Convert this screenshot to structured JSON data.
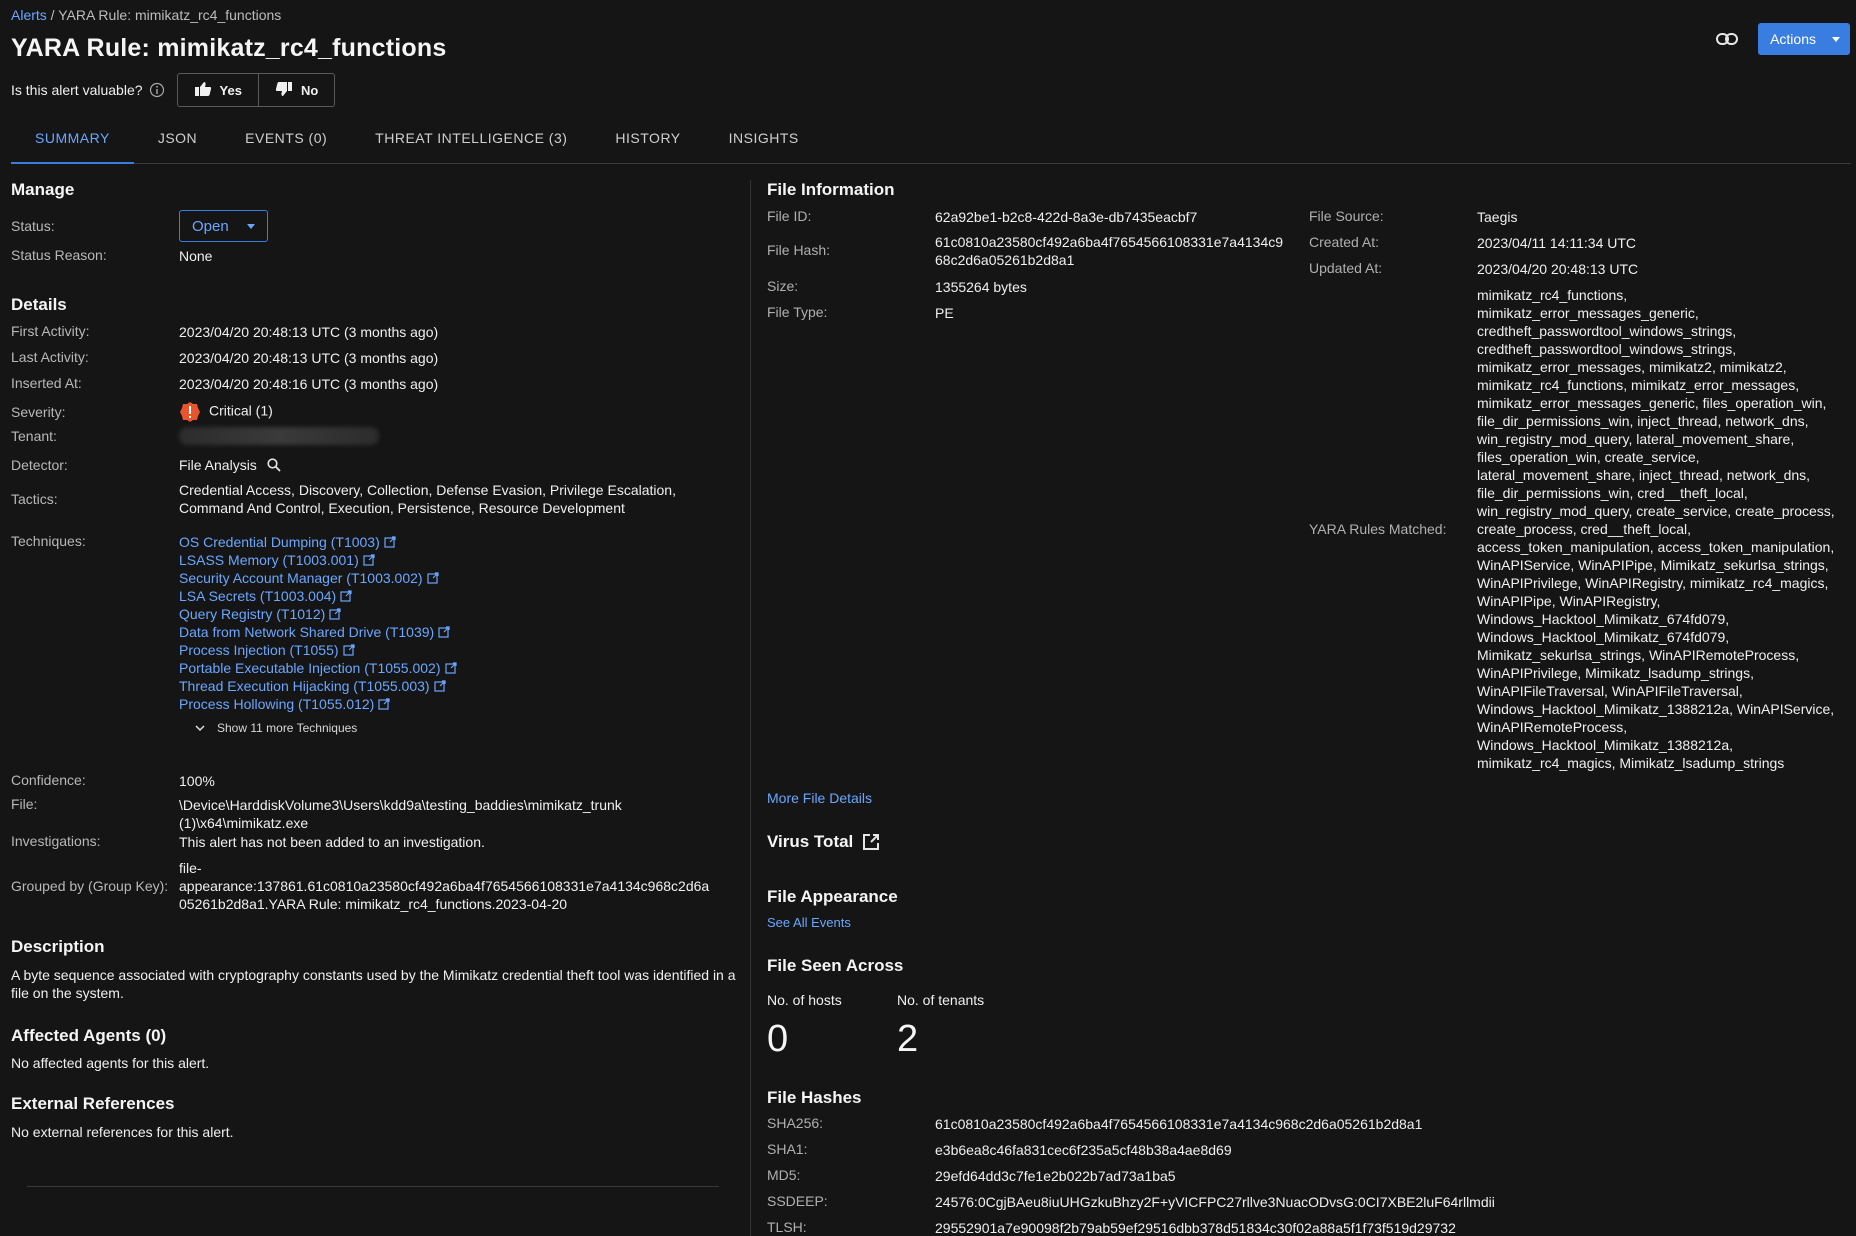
{
  "breadcrumb": {
    "root": "Alerts",
    "sep": " / ",
    "current": "YARA Rule: mimikatz_rc4_functions"
  },
  "title": "YARA Rule: mimikatz_rc4_functions",
  "header": {
    "actions_label": "Actions"
  },
  "feedback": {
    "question": "Is this alert valuable?",
    "yes": "Yes",
    "no": "No"
  },
  "tabs": [
    "SUMMARY",
    "JSON",
    "EVENTS (0)",
    "THREAT INTELLIGENCE (3)",
    "HISTORY",
    "INSIGHTS"
  ],
  "manage": {
    "title": "Manage",
    "status_label": "Status:",
    "status_value": "Open",
    "reason_label": "Status Reason:",
    "reason_value": "None"
  },
  "details": {
    "title": "Details",
    "first_activity_label": "First Activity:",
    "first_activity": "2023/04/20 20:48:13 UTC (3 months ago)",
    "last_activity_label": "Last Activity:",
    "last_activity": "2023/04/20 20:48:13 UTC (3 months ago)",
    "inserted_label": "Inserted At:",
    "inserted": "2023/04/20 20:48:16 UTC (3 months ago)",
    "severity_label": "Severity:",
    "severity": "Critical (1)",
    "tenant_label": "Tenant:",
    "detector_label": "Detector:",
    "detector": "File Analysis",
    "tactics_label": "Tactics:",
    "tactics_line1": "Credential Access, Discovery, Collection, Defense Evasion, Privilege Escalation,",
    "tactics_line2": "Command And Control, Execution, Persistence, Resource Development",
    "techniques_label": "Techniques:",
    "techniques": [
      "OS Credential Dumping (T1003)",
      "LSASS Memory (T1003.001)",
      "Security Account Manager (T1003.002)",
      "LSA Secrets (T1003.004)",
      "Query Registry (T1012)",
      "Data from Network Shared Drive (T1039)",
      "Process Injection (T1055)",
      "Portable Executable Injection (T1055.002)",
      "Thread Execution Hijacking (T1055.003)",
      "Process Hollowing (T1055.012)"
    ],
    "show_more": "Show 11 more Techniques",
    "confidence_label": "Confidence:",
    "confidence": "100%",
    "file_label": "File:",
    "file_line1": "\\Device\\HarddiskVolume3\\Users\\kdd9a\\testing_baddies\\mimikatz_trunk",
    "file_line2": "(1)\\x64\\mimikatz.exe",
    "investigations_label": "Investigations:",
    "investigations": "This alert has not been added to an investigation.",
    "group_label": "Grouped by (Group Key):",
    "group_line1": "file-",
    "group_line2": "appearance:137861.61c0810a23580cf492a6ba4f7654566108331e7a4134c968c2d6a",
    "group_line3": "05261b2d8a1.YARA Rule: mimikatz_rc4_functions.2023-04-20"
  },
  "description": {
    "title": "Description",
    "line1": "A byte sequence associated with cryptography constants used by the Mimikatz credential theft tool was identified in a",
    "line2": "file on the system."
  },
  "agents": {
    "title": "Affected Agents  (0)",
    "text": "No affected agents for this alert."
  },
  "references": {
    "title": "External References",
    "text": "No external references for this alert."
  },
  "file_info": {
    "title": "File Information",
    "id_label": "File ID:",
    "id": "62a92be1-b2c8-422d-8a3e-db7435eacbf7",
    "hash_label": "File Hash:",
    "hash_line1": "61c0810a23580cf492a6ba4f7654566108331e7a4134c9",
    "hash_line2": "68c2d6a05261b2d8a1",
    "size_label": "Size:",
    "size": "1355264 bytes",
    "type_label": "File Type:",
    "type": "PE",
    "source_label": "File Source:",
    "source": "Taegis",
    "created_label": "Created At:",
    "created": "2023/04/11 14:11:34 UTC",
    "updated_label": "Updated At:",
    "updated": "2023/04/20 20:48:13 UTC",
    "yara_label": "YARA Rules Matched:",
    "yara_lines": [
      "mimikatz_rc4_functions,",
      "mimikatz_error_messages_generic,",
      "credtheft_passwordtool_windows_strings,",
      "credtheft_passwordtool_windows_strings,",
      "mimikatz_error_messages, mimikatz2, mimikatz2,",
      "mimikatz_rc4_functions, mimikatz_error_messages,",
      "mimikatz_error_messages_generic, files_operation_win,",
      "file_dir_permissions_win, inject_thread, network_dns,",
      "win_registry_mod_query, lateral_movement_share,",
      "files_operation_win, create_service,",
      "lateral_movement_share, inject_thread, network_dns,",
      "file_dir_permissions_win, cred__theft_local,",
      "win_registry_mod_query, create_service, create_process,",
      "create_process, cred__theft_local,",
      "access_token_manipulation, access_token_manipulation,",
      "WinAPIService, WinAPIPipe, Mimikatz_sekurlsa_strings,",
      "WinAPIPrivilege, WinAPIRegistry, mimikatz_rc4_magics,",
      "WinAPIPipe, WinAPIRegistry,",
      "Windows_Hacktool_Mimikatz_674fd079,",
      "Windows_Hacktool_Mimikatz_674fd079,",
      "Mimikatz_sekurlsa_strings, WinAPIRemoteProcess,",
      "WinAPIPrivilege, Mimikatz_lsadump_strings,",
      "WinAPIFileTraversal, WinAPIFileTraversal,",
      "Windows_Hacktool_Mimikatz_1388212a, WinAPIService,",
      "WinAPIRemoteProcess,",
      "Windows_Hacktool_Mimikatz_1388212a,",
      "mimikatz_rc4_magics, Mimikatz_lsadump_strings"
    ],
    "more_details": "More File Details"
  },
  "virus_total": {
    "title": "Virus Total"
  },
  "appearance": {
    "title": "File Appearance",
    "link": "See All Events"
  },
  "seen": {
    "title": "File Seen Across",
    "hosts_label": "No. of hosts",
    "hosts": "0",
    "tenants_label": "No. of tenants",
    "tenants": "2"
  },
  "hashes": {
    "title": "File Hashes",
    "sha256_label": "SHA256:",
    "sha256": "61c0810a23580cf492a6ba4f7654566108331e7a4134c968c2d6a05261b2d8a1",
    "sha1_label": "SHA1:",
    "sha1": "e3b6ea8c46fa831cec6f235a5cf48b38a4ae8d69",
    "md5_label": "MD5:",
    "md5": "29efd64dd3c7fe1e2b022b7ad73a1ba5",
    "ssdeep_label": "SSDEEP:",
    "ssdeep": "24576:0CgjBAeu8iuUHGzkuBhzy2F+yVICFPC27rllve3NuacODvsG:0CI7XBE2luF64rllmdii",
    "tlsh_label": "TLSH:",
    "tlsh": "29552901a7e90098f2b79ab59ef29516dbb378d51834c30f02a88a5f1f73f519d29732"
  }
}
